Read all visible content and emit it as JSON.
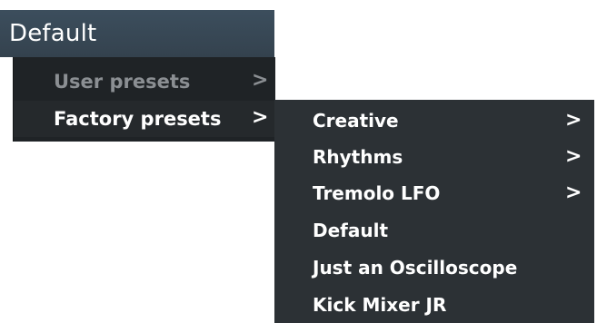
{
  "header": {
    "title": "Default"
  },
  "main_menu": {
    "items": [
      {
        "label": "User presets",
        "chevron": ">",
        "state": "disabled"
      },
      {
        "label": "Factory presets",
        "chevron": ">",
        "state": "active"
      }
    ]
  },
  "submenu": {
    "items": [
      {
        "label": "Creative",
        "chevron": ">"
      },
      {
        "label": "Rhythms",
        "chevron": ">"
      },
      {
        "label": "Tremolo LFO",
        "chevron": ">"
      },
      {
        "label": "Default",
        "chevron": ""
      },
      {
        "label": "Just an Oscilloscope",
        "chevron": ""
      },
      {
        "label": "Kick Mixer JR",
        "chevron": ""
      }
    ]
  },
  "colors": {
    "header_bg": "#3c4e5d",
    "menu_bg": "#1f2326",
    "submenu_bg": "#2c3135",
    "text_active": "#ffffff",
    "text_disabled": "#8b8f93"
  }
}
